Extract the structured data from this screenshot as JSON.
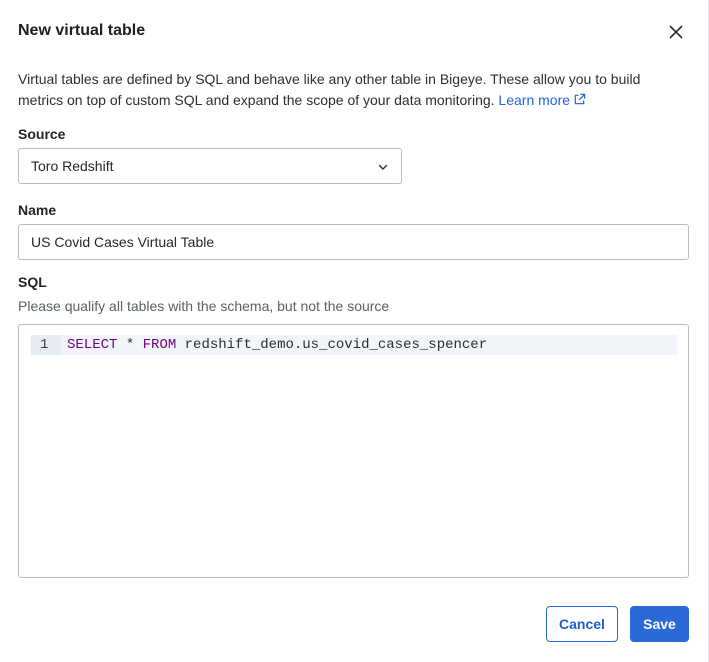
{
  "dialog": {
    "title": "New virtual table",
    "description": "Virtual tables are defined by SQL and behave like any other table in Bigeye. These allow you to build metrics on top of custom SQL and expand the scope of your data monitoring.",
    "learn_more": "Learn more"
  },
  "source": {
    "label": "Source",
    "selected": "Toro Redshift"
  },
  "name": {
    "label": "Name",
    "value": "US Covid Cases Virtual Table"
  },
  "sql": {
    "label": "SQL",
    "hint": "Please qualify all tables with the schema, but not the source",
    "line_number": "1",
    "kw_select": "SELECT",
    "op_star": " * ",
    "kw_from": "FROM",
    "table_ref": " redshift_demo.us_covid_cases_spencer"
  },
  "actions": {
    "cancel": "Cancel",
    "save": "Save"
  },
  "colors": {
    "primary": "#2a6ad6",
    "keyword": "#770088",
    "link": "#2266d8"
  }
}
